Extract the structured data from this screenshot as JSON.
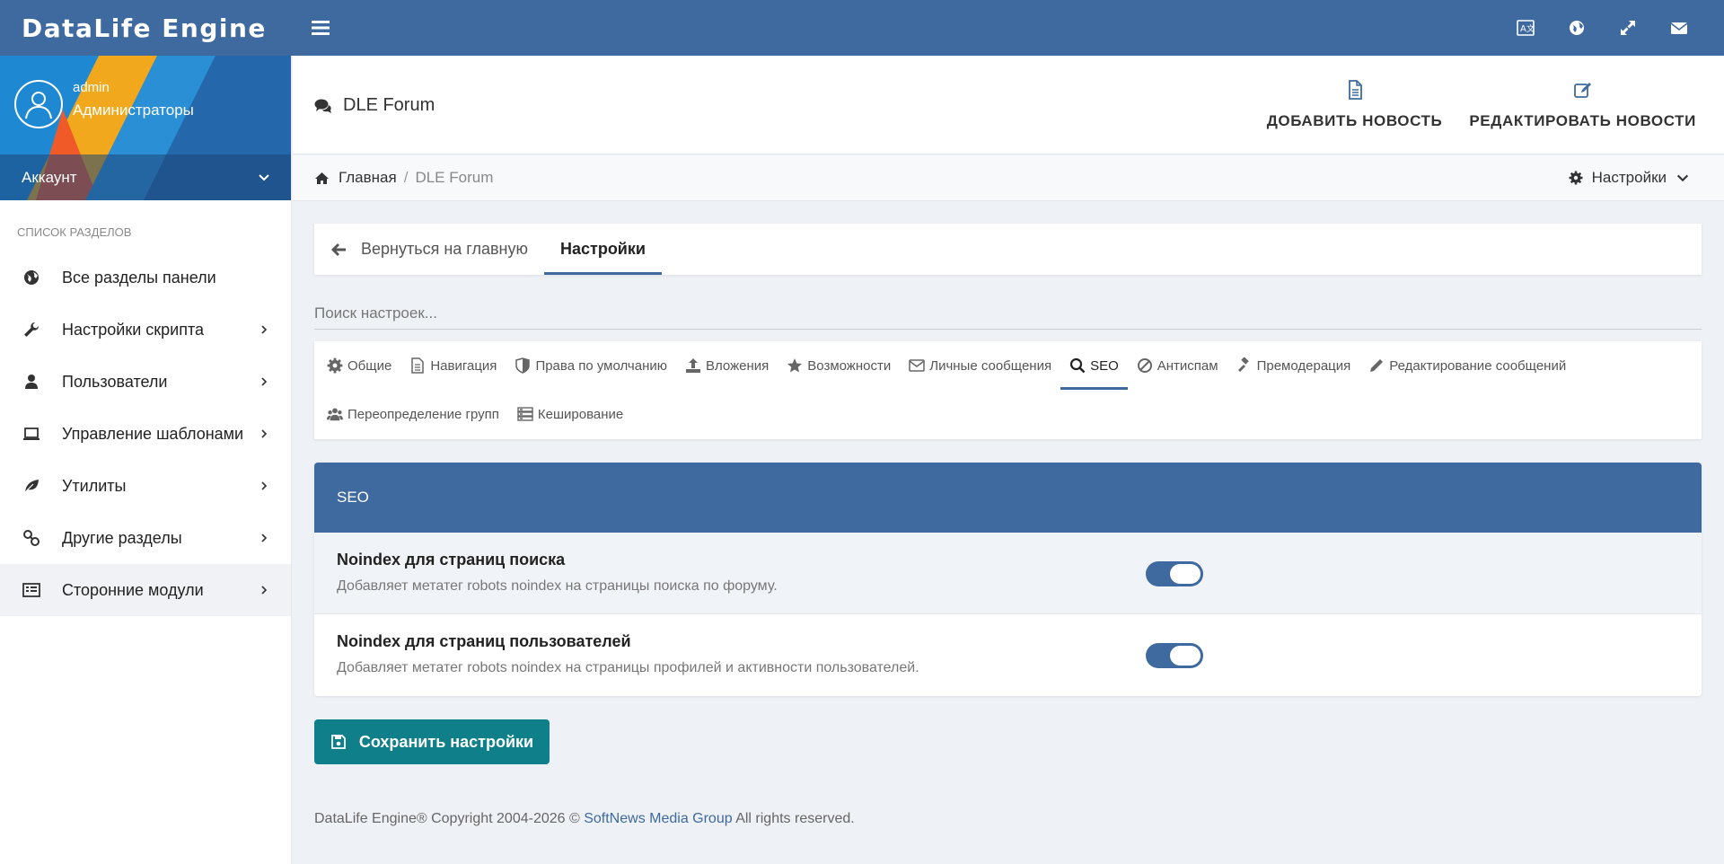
{
  "brand": "DataLife Engine",
  "topbar_icons": [
    "language-icon",
    "globe-icon",
    "fullscreen-icon",
    "mail-icon"
  ],
  "user": {
    "name": "admin",
    "group": "Администраторы",
    "account_label": "Аккаунт"
  },
  "sidebar": {
    "section_title": "СПИСОК РАЗДЕЛОВ",
    "items": [
      {
        "label": "Все разделы панели",
        "icon": "globe-icon",
        "has_arrow": false
      },
      {
        "label": "Настройки скрипта",
        "icon": "wrench-icon",
        "has_arrow": true
      },
      {
        "label": "Пользователи",
        "icon": "user-icon",
        "has_arrow": true
      },
      {
        "label": "Управление шаблонами",
        "icon": "laptop-icon",
        "has_arrow": true
      },
      {
        "label": "Утилиты",
        "icon": "leaf-icon",
        "has_arrow": true
      },
      {
        "label": "Другие разделы",
        "icon": "link-icon",
        "has_arrow": true
      },
      {
        "label": "Сторонние модули",
        "icon": "list-icon",
        "has_arrow": true
      }
    ]
  },
  "header": {
    "title": "DLE Forum",
    "add_news": "ДОБАВИТЬ НОВОСТЬ",
    "edit_news": "РЕДАКТИРОВАТЬ НОВОСТИ"
  },
  "breadcrumb": {
    "home": "Главная",
    "separator": "/",
    "current": "DLE Forum",
    "settings": "Настройки"
  },
  "tabs": {
    "back": "Вернуться на главную",
    "settings": "Настройки"
  },
  "search": {
    "placeholder": "Поиск настроек..."
  },
  "categories": {
    "row1": [
      {
        "label": "Общие",
        "icon": "gear-icon"
      },
      {
        "label": "Навигация",
        "icon": "document-icon"
      },
      {
        "label": "Права по умолчанию",
        "icon": "shield-icon"
      },
      {
        "label": "Вложения",
        "icon": "upload-icon"
      },
      {
        "label": "Возможности",
        "icon": "star-icon"
      },
      {
        "label": "Личные сообщения",
        "icon": "envelope-icon"
      },
      {
        "label": "SEO",
        "icon": "search-icon",
        "active": true
      },
      {
        "label": "Антиспам",
        "icon": "ban-icon"
      },
      {
        "label": "Премодерация",
        "icon": "gavel-icon"
      },
      {
        "label": "Редактирование сообщений",
        "icon": "pencil-icon"
      }
    ],
    "row2": [
      {
        "label": "Переопределение групп",
        "icon": "users-icon"
      },
      {
        "label": "Кеширование",
        "icon": "server-icon"
      }
    ]
  },
  "seo": {
    "title": "SEO",
    "settings": [
      {
        "title": "Noindex для страниц поиска",
        "description": "Добавляет метатег robots noindex на страницы поиска по форуму.",
        "enabled": true
      },
      {
        "title": "Noindex для страниц пользователей",
        "description": "Добавляет метатег robots noindex на страницы профилей и активности пользователей.",
        "enabled": true
      }
    ]
  },
  "save_button": "Сохранить настройки",
  "footer": {
    "prefix": "DataLife Engine® Copyright 2004-2026 ©",
    "link": "SoftNews Media Group",
    "suffix": "All rights reserved."
  },
  "colors": {
    "primary": "#3f6a9f",
    "save_button": "#0f7f8a",
    "background": "#eef1f5"
  }
}
